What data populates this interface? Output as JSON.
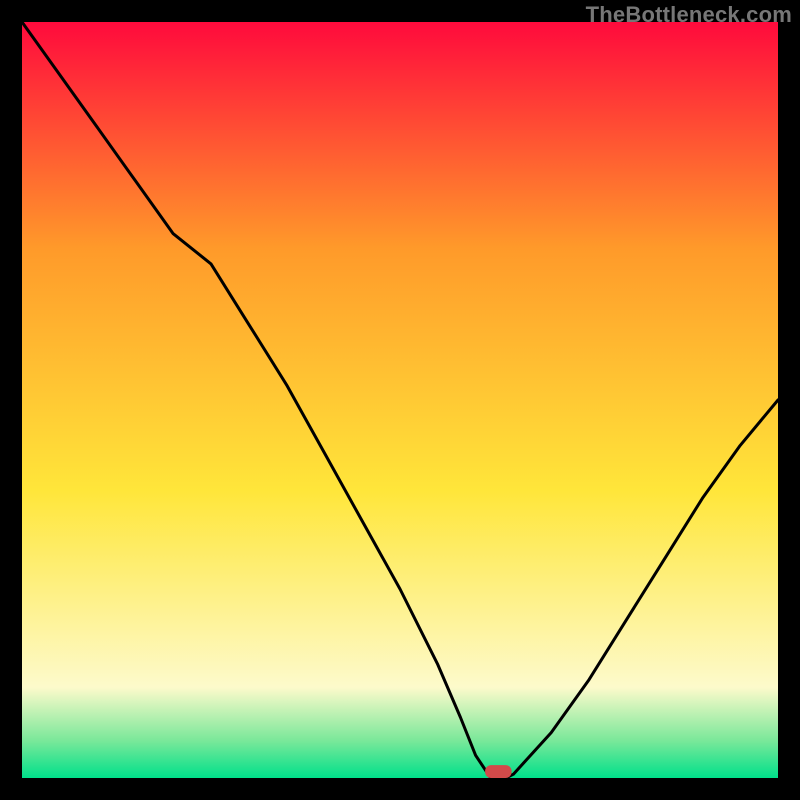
{
  "watermark": "TheBottleneck.com",
  "colors": {
    "frame": "#000000",
    "curve": "#000000",
    "marker": "#d24a4a",
    "gradient_top": "#ff0a3c",
    "gradient_mid_orange": "#ff9a2a",
    "gradient_yellow": "#ffe63a",
    "gradient_pale": "#fdfacb",
    "gradient_green_light": "#7be89a",
    "gradient_green": "#00e08a"
  },
  "chart_data": {
    "type": "line",
    "title": "",
    "xlabel": "",
    "ylabel": "",
    "xlim": [
      0,
      100
    ],
    "ylim": [
      0,
      100
    ],
    "series": [
      {
        "name": "bottleneck-curve",
        "x": [
          0,
          5,
          10,
          15,
          20,
          25,
          30,
          35,
          40,
          45,
          50,
          55,
          58,
          60,
          62,
          64,
          65,
          70,
          75,
          80,
          85,
          90,
          95,
          100
        ],
        "y": [
          100,
          93,
          86,
          79,
          72,
          68,
          60,
          52,
          43,
          34,
          25,
          15,
          8,
          3,
          0,
          0,
          0.5,
          6,
          13,
          21,
          29,
          37,
          44,
          50
        ]
      }
    ],
    "marker": {
      "x": 63,
      "y": 0,
      "width": 3.5,
      "height": 1.7
    },
    "gradient_stops": [
      {
        "pos": 0.0,
        "key": "gradient_top"
      },
      {
        "pos": 0.3,
        "key": "gradient_mid_orange"
      },
      {
        "pos": 0.62,
        "key": "gradient_yellow"
      },
      {
        "pos": 0.88,
        "key": "gradient_pale"
      },
      {
        "pos": 0.95,
        "key": "gradient_green_light"
      },
      {
        "pos": 1.0,
        "key": "gradient_green"
      }
    ]
  }
}
